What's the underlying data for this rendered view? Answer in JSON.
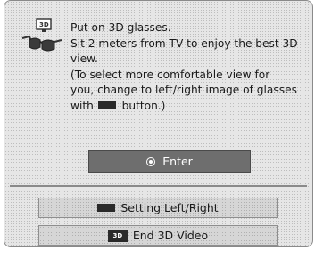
{
  "dialog": {
    "message_lines": [
      "Put on 3D glasses.",
      "Sit 2 meters from TV to enjoy the best 3D",
      "view.",
      "(To select more comfortable view for",
      "you, change to left/right image of glasses",
      "with",
      "button.)"
    ],
    "enter_label": "Enter",
    "setting_label": "Setting Left/Right",
    "end3d_label": "End 3D Video",
    "badge_3d_text": "3D",
    "icons": {
      "glasses": "3d-glasses-icon",
      "radio": "radio-selected-icon",
      "button_swatch": "button-swatch-icon",
      "badge": "3d-badge-icon"
    }
  }
}
